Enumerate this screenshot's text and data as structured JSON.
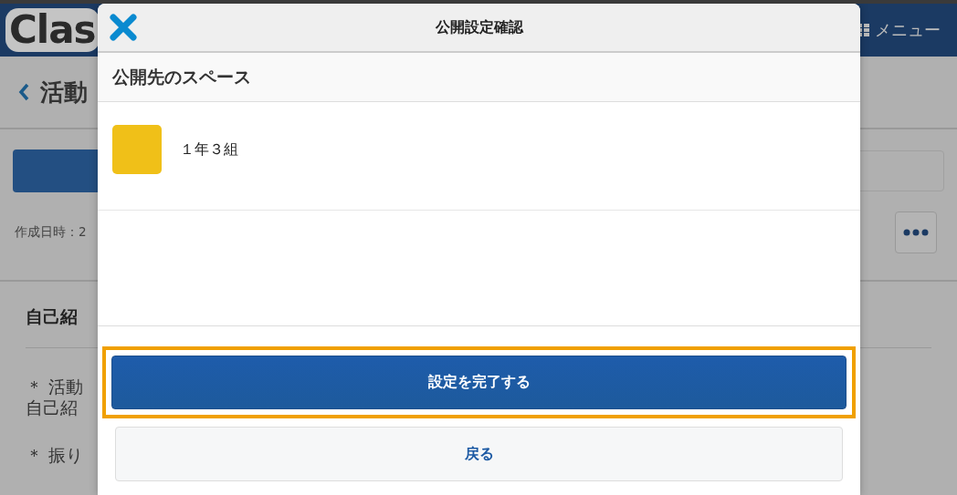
{
  "page": {
    "logo": "Clas",
    "menu": "メニュー",
    "title": "活動",
    "created": "作成日時：2",
    "section_title": "自己紹",
    "lines": [
      "＊ 活動",
      "自己紹",
      "＊ 振り"
    ]
  },
  "dialog": {
    "title": "公開設定確認",
    "section": "公開先のスペース",
    "spaces": [
      {
        "name": "１年３組",
        "color": "#f0c018"
      }
    ],
    "buttons": [
      {
        "label": "設定を完了する",
        "kind": "primary",
        "highlighted": true
      },
      {
        "label": "戻る",
        "kind": "secondary",
        "highlighted": false
      }
    ]
  }
}
